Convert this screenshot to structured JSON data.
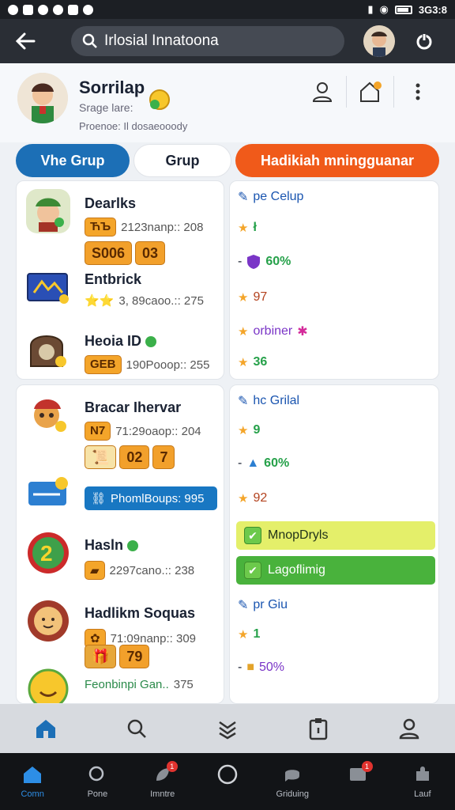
{
  "status_bar": {
    "time": "3G3:8"
  },
  "search": {
    "value": "Irlosial Innatoona"
  },
  "profile": {
    "name": "Sorrilap",
    "sub": "Srage lare:",
    "desc": "Proenoe: Il dosaeooody"
  },
  "tabs": [
    "Vhe Grup",
    "Grup",
    "Hadikiah mningguanar"
  ],
  "left_panel_1": {
    "games": [
      {
        "title": "Dearlks",
        "chip": "ЋЪ",
        "meta": "2123nanp:: 208",
        "chips": [
          "S006",
          "03"
        ]
      },
      {
        "title": "Entbrick",
        "chip": "⭐⭐",
        "meta": "3, 89caoo.:: 275"
      },
      {
        "title": "Heoia ID",
        "chip": "GEB",
        "meta": "190Pooop:: 255"
      }
    ]
  },
  "right_panel_1": {
    "header": "pe Celup",
    "lines": [
      "ł",
      "60%",
      "97",
      "orbiner",
      "36"
    ]
  },
  "left_panel_2": {
    "games": [
      {
        "title": "Bracar Ihervar",
        "chip": "N7",
        "meta": "71:29oaop:: 204",
        "chips": [
          "02",
          "7"
        ]
      },
      {
        "promo": "PhomlBoups: 995"
      },
      {
        "title": "Hasln",
        "chip": "",
        "meta": "2297cano.:: 238"
      },
      {
        "title": "Hadlikm Soquas",
        "chip": "",
        "meta": "71:09nanp:: 309"
      },
      {
        "title": "Feonbinpi Gan..",
        "chip": "",
        "meta": "375",
        "chips": [
          "79"
        ]
      }
    ]
  },
  "right_panel_2": {
    "header": "hc Grilal",
    "lines": [
      "9",
      "60%",
      "92"
    ],
    "buttons": [
      "MnopDryls",
      "Lagoflimig"
    ],
    "header2": "pr Giu",
    "lines2": [
      "1",
      "50%"
    ]
  },
  "sys_nav": [
    "Comn",
    "Pone",
    "Imntre",
    "",
    "Griduing",
    "",
    "Lauf"
  ],
  "colors": {
    "accent_blue": "#1c6fb6",
    "accent_orange": "#f05a1a",
    "green": "#49b23c",
    "yellow": "#e4ef6a"
  }
}
